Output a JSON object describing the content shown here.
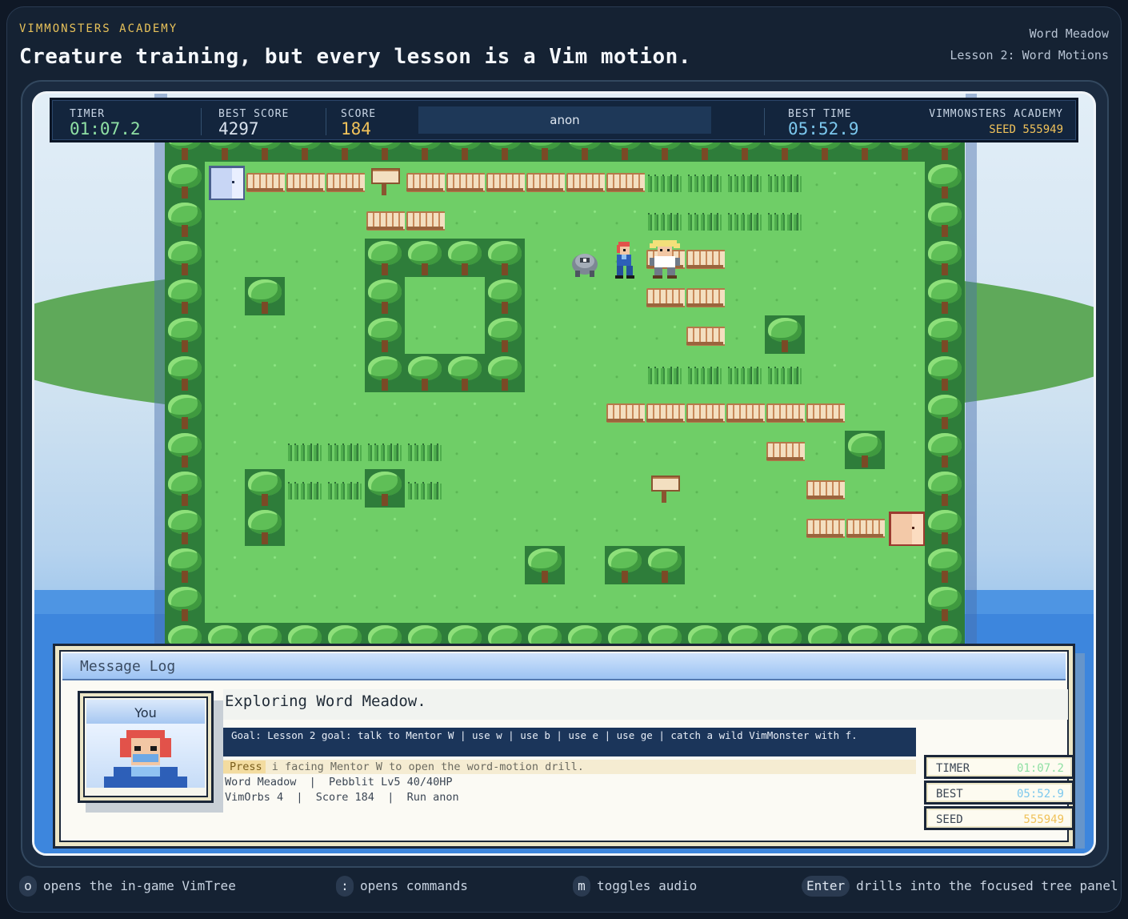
{
  "header": {
    "brand": "VIMMONSTERS ACADEMY",
    "headline": "Creature training, but every lesson is a Vim motion.",
    "level": "Word Meadow",
    "lesson": "Lesson 2: Word Motions"
  },
  "hud": {
    "timer_label": "TIMER",
    "timer_value": "01:07.2",
    "best_score_label": "BEST SCORE",
    "best_score_value": "4297",
    "score_label": "SCORE",
    "score_value": "184",
    "player_name": "anon",
    "best_time_label": "BEST TIME",
    "best_time_value": "05:52.9",
    "academy_label": "VIMMONSTERS ACADEMY",
    "seed_label": "SEED",
    "seed_value": "555949",
    "colors": {
      "timer": "#8fe0a4",
      "best_score": "#d9e2ee",
      "score": "#f0c25a",
      "best_time": "#7cc8ee",
      "seed": "#f0c25a"
    }
  },
  "map": {
    "legend": {
      "T": "tree",
      "g": "grass",
      "t": "tall-grass",
      "f": "fence",
      "s": "signpost",
      "D": "blue-door",
      "R": "red-door"
    },
    "rows": [
      "TTTTTTTTTTTTTTTTTTTT",
      "TDfffsffffffttttgggT",
      "TggggffgggggttttgggT",
      "TggggTTTTgggffgggggT",
      "TgTggTggTgggffgggggT",
      "TggggTggTggggfgTgggT",
      "TggggTTTTgggttttgggT",
      "TggggggggggffffffgggT",
      "TggttttggggggggfgTgT",
      "TgTttTtgggggsgggfgggT",
      "TgTgggggggggggggffRT",
      "TggggggggTgTTgggggggT",
      "TgggggggggggggggggggT",
      "TTTTTTTTTTTTTTTTTTTT"
    ],
    "sprites": [
      {
        "kind": "wild-monster",
        "col": 10,
        "row": 3
      },
      {
        "kind": "player",
        "col": 11,
        "row": 3
      },
      {
        "kind": "mentor-w",
        "col": 12,
        "row": 3
      }
    ]
  },
  "message_log": {
    "title": "Message Log",
    "portrait_name": "You",
    "status": "Exploring Word Meadow.",
    "goal": "Goal: Lesson 2 goal: talk to Mentor W | use w | use b | use e | use ge | catch a wild VimMonster with f.",
    "hint_key": "Press",
    "hint_rest": " i facing Mentor W to open the word-motion drill.",
    "info_line1": "Word Meadow  |  Pebblit Lv5 40/40HP",
    "info_line2": "VimOrbs 4  |  Score 184  |  Run anon",
    "stats": [
      {
        "key": "TIMER",
        "value": "01:07.2",
        "color": "#8fe0a4"
      },
      {
        "key": "BEST",
        "value": "05:52.9",
        "color": "#7cc8ee"
      },
      {
        "key": "SEED",
        "value": "555949",
        "color": "#f0c25a"
      }
    ]
  },
  "footer": [
    {
      "key": "o",
      "text": "opens the in-game VimTree"
    },
    {
      "key": ":",
      "text": "opens commands"
    },
    {
      "key": "m",
      "text": "toggles audio"
    },
    {
      "key": "Enter",
      "text": "drills into the focused tree panel"
    }
  ]
}
